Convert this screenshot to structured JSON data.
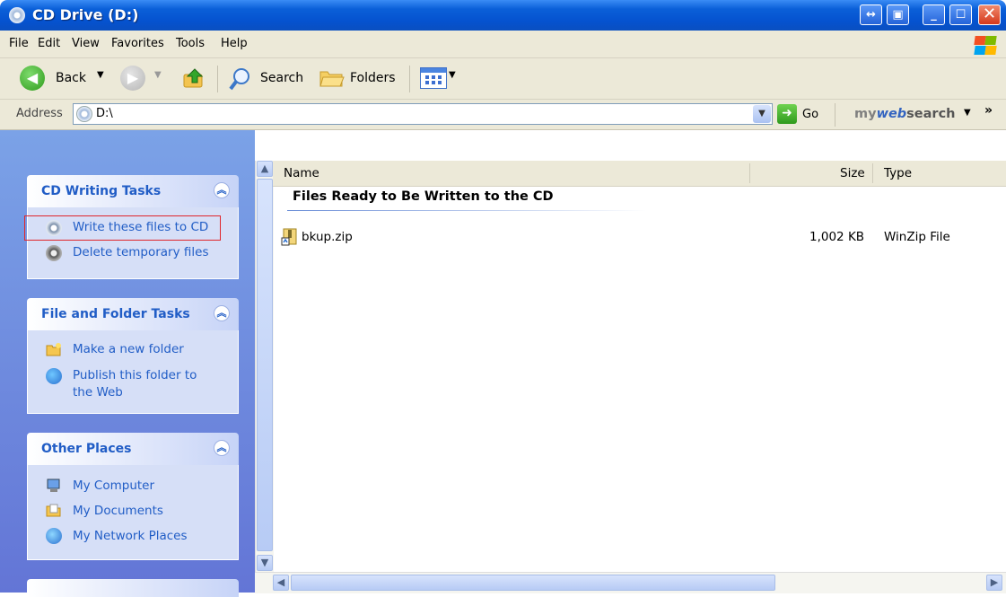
{
  "window": {
    "title": "CD Drive (D:)"
  },
  "menu": [
    "File",
    "Edit",
    "View",
    "Favorites",
    "Tools",
    "Help"
  ],
  "toolbar": {
    "back": "Back",
    "search": "Search",
    "folders": "Folders"
  },
  "address": {
    "label": "Address",
    "value": "D:\\",
    "go": "Go",
    "mywebsearch_prefix": "my",
    "mywebsearch_bold": "web",
    "mywebsearch_suffix": "search",
    "overflow": "»"
  },
  "panels": {
    "cd_writing": {
      "title": "CD Writing Tasks",
      "items": [
        "Write these files to CD",
        "Delete temporary files"
      ]
    },
    "file_folder": {
      "title": "File and Folder Tasks",
      "items": [
        "Make a new folder",
        "Publish this folder to the Web"
      ]
    },
    "other_places": {
      "title": "Other Places",
      "items": [
        "My Computer",
        "My Documents",
        "My Network Places"
      ]
    }
  },
  "columns": {
    "name": "Name",
    "size": "Size",
    "type": "Type"
  },
  "group_title": "Files Ready to Be Written to the CD",
  "files": [
    {
      "name": "bkup.zip",
      "size": "1,002 KB",
      "type": "WinZip File"
    }
  ],
  "colors": {
    "titlebar": "#0a5fd8",
    "panel_bg": "#6f8fe0",
    "link": "#215dc6",
    "highlight_box": "#e0262b"
  }
}
